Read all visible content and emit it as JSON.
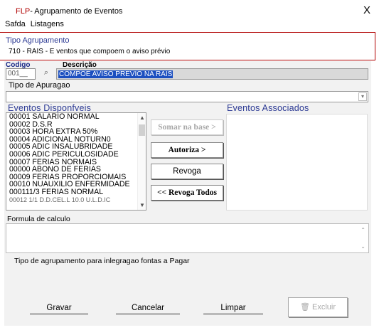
{
  "window": {
    "title_prefix": "FLP",
    "title_rest": "- Agrupamento de Eventos",
    "close": "X"
  },
  "menu": [
    "Safda",
    "Listagens"
  ],
  "header": {
    "label": "Tipo Agrupamento",
    "value": "710 - RAIS - E ventos que compoem o aviso prévio"
  },
  "form": {
    "codigo_label": "Codigo",
    "codigo_value": "001__",
    "descricao_label": "Descrição",
    "descricao_value": "COMPOE AVISO PREVIO NA RAIS",
    "apuracao_label": "Tipo de Apuragao",
    "apuracao_value": ""
  },
  "events": {
    "available_label": "Eventos Disponfveis",
    "associated_label": "Eventos Associados",
    "available": [
      "00001 SALARIO NORMAL",
      "00002 D.S.R",
      "00003 HORA EXTRA 50%",
      "00004 ADICIONAL NOTURN0",
      "00005 ADIC INSALUBRIDADE",
      "00006 ADIC PERICULOSIDADE",
      "00007 FERIAS NORMAIS",
      "00000 ABONO DE FERIAS",
      "00009 FERIAS PROPORCIOMAIS",
      "00010 NUAUXILIO ENFERMIDADE",
      "000111/3 FERIAS NORMAL"
    ],
    "cut_item": "00012 1/1 D.D.CEL.L 10.0 U.L.D.IC"
  },
  "buttons": {
    "somar": "Somar na base >",
    "autoriza": "Autoriza >",
    "revoga": "Revoga",
    "revoga_todos": "<< Revoga Todos"
  },
  "formula_label": "Formula de calculo",
  "tipo_label": "Tipo de agrupamento para inlegragao fontas a Pagar",
  "footer": {
    "gravar": "Gravar",
    "cancelar": "Cancelar",
    "limpar": "Limpar",
    "excluir": "Excluir"
  },
  "colors": {
    "accent_red": "#b00000",
    "label_blue": "#2c3a94",
    "selection_blue": "#1c4fc0"
  }
}
